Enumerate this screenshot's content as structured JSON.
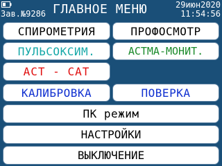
{
  "header": {
    "serial": "Зав.№9286",
    "title": "ГЛАВНОЕ МЕНЮ",
    "date": "29июн2020",
    "time": "11:54:56",
    "battery_icon": "battery-icon"
  },
  "menu": {
    "spirometry": "СПИРОМЕТРИЯ",
    "checkup": "ПРОФОСМОТР",
    "pulse_oximetry": "ПУЛЬСОКСИМ.",
    "asthma_monitor": "АСТМА-МОНИТ.",
    "act_cat": "ACT - CAT",
    "calibration": "КАЛИБРОВКА",
    "verification": "ПОВЕРКА",
    "pc_mode": "ПК режим",
    "settings": "НАСТРОЙКИ",
    "power_off": "ВЫКЛЮЧЕНИЕ"
  },
  "colors": {
    "background": "#1a4f78",
    "button": "#ffffff",
    "pulse_text": "#16a8a8",
    "asthma_text": "#1a8a2a",
    "act_text": "#e01010",
    "calibration_text": "#1030d0"
  }
}
